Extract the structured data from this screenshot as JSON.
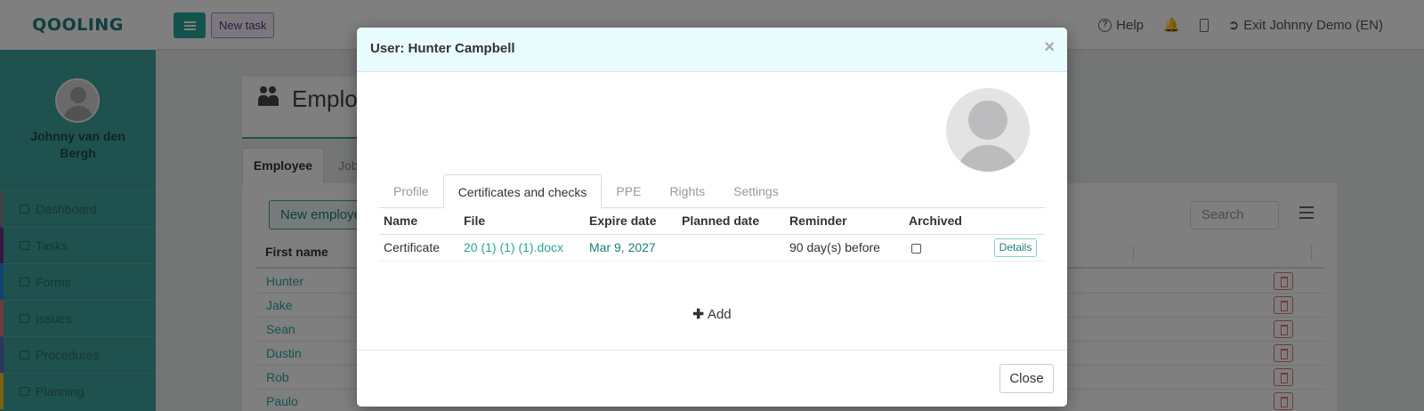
{
  "app": {
    "logo": "QOOLING",
    "new_task_label": "New task",
    "top_right": {
      "help_label": "Help",
      "exit_label": "Exit Johnny Demo (EN)"
    }
  },
  "sidebar": {
    "user_name": "Johnny van den Bergh",
    "items": [
      {
        "label": "Dashboard",
        "color": "#7e8b8a"
      },
      {
        "label": "Tasks",
        "color": "#6a2c8a"
      },
      {
        "label": "Forms",
        "color": "#1e88e5"
      },
      {
        "label": "Issues",
        "color": "#e57373"
      },
      {
        "label": "Procedures",
        "color": "#5c6bc0"
      },
      {
        "label": "Planning",
        "color": "#fbc02d"
      }
    ]
  },
  "page": {
    "title": "Employ",
    "tabs": [
      "Employee",
      "Job"
    ],
    "new_employee_label": "New employe",
    "search_placeholder": "Search",
    "table_header_first_name": "First name",
    "rows": [
      "Hunter",
      "Jake",
      "Sean",
      "Dustin",
      "Rob",
      "Paulo"
    ]
  },
  "modal": {
    "title": "User: Hunter Campbell",
    "close_x": "×",
    "tabs": [
      {
        "label": "Profile",
        "active": false
      },
      {
        "label": "Certificates and checks",
        "active": true
      },
      {
        "label": "PPE",
        "active": false
      },
      {
        "label": "Rights",
        "active": false
      },
      {
        "label": "Settings",
        "active": false
      }
    ],
    "table": {
      "headers": [
        "Name",
        "File",
        "Expire date",
        "Planned date",
        "Reminder",
        "Archived"
      ],
      "rows": [
        {
          "name": "Certificate",
          "file": "20 (1) (1) (1).docx",
          "expire_date": "Mar 9, 2027",
          "planned_date": "",
          "reminder": "90 day(s) before",
          "archived": false,
          "details_label": "Details"
        }
      ]
    },
    "add_label": "Add",
    "close_label": "Close"
  },
  "colors": {
    "accent": "#26a69a",
    "sidebar": "#3fa29c",
    "modal_header": "#e8fbfd"
  }
}
